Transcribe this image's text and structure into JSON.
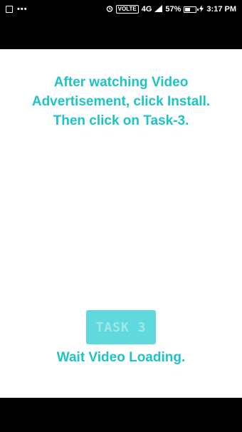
{
  "status_bar": {
    "carrier_label": "VOLTE",
    "network": "4G",
    "battery_percent": "57%",
    "time": "3:17 PM",
    "battery_level": 0.57,
    "icons": [
      "image-icon",
      "more-dots-icon",
      "alarm-icon",
      "signal-icon",
      "battery-icon",
      "charging-icon"
    ]
  },
  "main": {
    "instructions": "After watching Video\nAdvertisement, click Install.\nThen click on Task-3.",
    "task_button_label": "TASK 3",
    "status_message": "Wait Video Loading."
  },
  "colors": {
    "accent": "#1ec3c8",
    "button_bg": "#5fd9dc",
    "button_text": "#9fe8ea"
  }
}
